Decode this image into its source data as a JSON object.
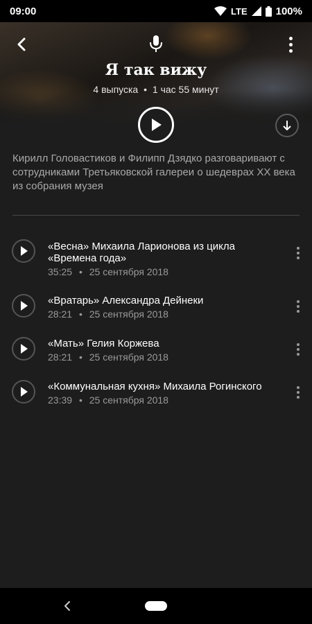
{
  "status_bar": {
    "time": "09:00",
    "network": "LTE",
    "battery": "100%"
  },
  "podcast": {
    "title": "Я так вижу",
    "episodes_count": "4 выпуска",
    "total_duration": "1 час 55 минут",
    "description": "Кирилл Головастиков и Филипп Дзядко разговаривают с сотрудниками Третьяковской галереи о шедеврах XX века из собрания музея"
  },
  "separator": "•",
  "episodes": [
    {
      "title": "«Весна» Михаила Ларионова из цикла «Времена года»",
      "duration": "35:25",
      "date": "25 сентября 2018"
    },
    {
      "title": "«Вратарь» Александра Дейнеки",
      "duration": "28:21",
      "date": "25 сентября 2018"
    },
    {
      "title": "«Мать» Гелия Коржева",
      "duration": "28:21",
      "date": "25 сентября 2018"
    },
    {
      "title": "«Коммунальная кухня» Михаила Рогинского",
      "duration": "23:39",
      "date": "25 сентября 2018"
    }
  ],
  "icons": {
    "back": "back-arrow-icon",
    "mic": "microphone-icon",
    "more": "more-vertical-icon",
    "play": "play-icon",
    "download": "download-icon"
  },
  "colors": {
    "background": "#1d1d1d",
    "secondary_text": "#a9a9a9",
    "divider": "#474747"
  }
}
